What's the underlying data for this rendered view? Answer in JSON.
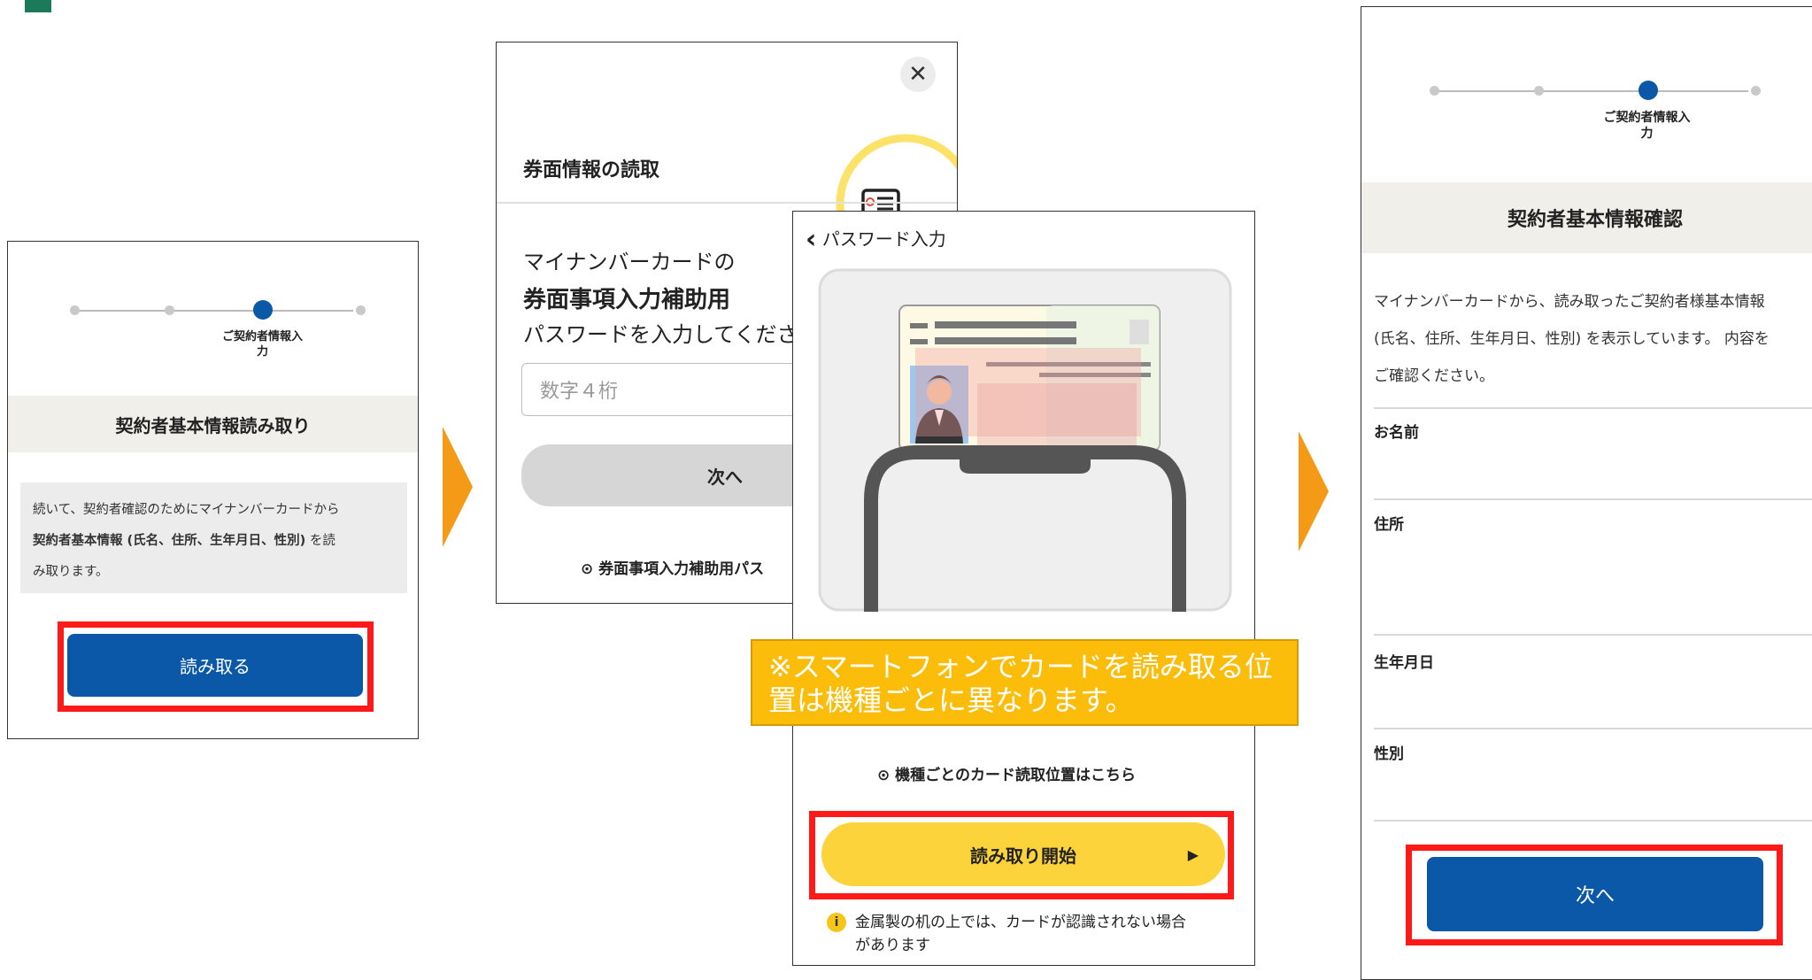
{
  "colors": {
    "primary": "#0b58a8",
    "highlight": "#ff1a1a",
    "arrow": "#f59a16",
    "note": "#fbbd0a",
    "yellow_button": "#fcd33a"
  },
  "screen1": {
    "step_caption": "ご契約者情報入力",
    "section_title": "契約者基本情報読み取り",
    "description_line1": "続いて、契約者確認のためにマイナンバーカードから",
    "description_bold": "契約者基本情報 (氏名、住所、生年月日、性別)",
    "description_rest1": " を読",
    "description_line3": "み取ります。",
    "read_button": "読み取る"
  },
  "screen2": {
    "title": "券面情報の読取",
    "close_icon": "close-icon",
    "prompt_line1": "マイナンバーカードの",
    "prompt_bold": "券面事項入力補助用",
    "prompt_line3": "パスワードを入力してくださ",
    "password_placeholder": "数字４桁",
    "next_button": "次へ",
    "help_link": "券面事項入力補助用パス"
  },
  "screen3": {
    "back_icon": "chevron-left-icon",
    "title": "パスワード入力",
    "note_line1": "※スマートフォンでカードを読み取る位",
    "note_line2": "置は機種ごとに異なります。",
    "position_link": "機種ごとのカード読取位置はこちら",
    "start_button": "読み取り開始",
    "warning_line1": "金属製の机の上では、カードが認識されない場合",
    "warning_line2": "があります"
  },
  "screen4": {
    "step_caption": "ご契約者情報入力",
    "section_title": "契約者基本情報確認",
    "description_line1": "マイナンバーカードから、読み取ったご契約者様基本情報",
    "description_line2": "(氏名、住所、生年月日、性別) を表示しています。 内容を",
    "description_line3": "ご確認ください。",
    "label_name": "お名前",
    "label_address": "住所",
    "label_birthdate": "生年月日",
    "label_gender": "性別",
    "next_button": "次へ"
  }
}
